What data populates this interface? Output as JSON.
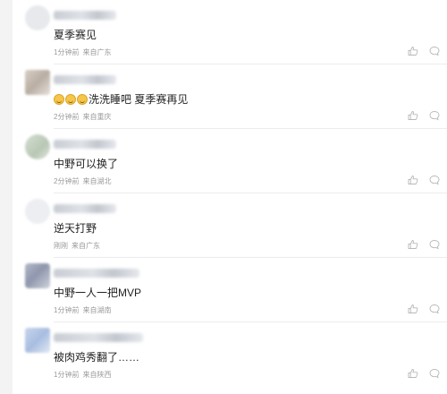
{
  "comments": [
    {
      "text": "夏季赛见",
      "time": "1分钟前",
      "location": "来自广东"
    },
    {
      "emoji": [
        "laugh-cry-emoji",
        "laugh-cry-emoji",
        "laugh-cry-emoji"
      ],
      "text": "洗洗睡吧 夏季赛再见",
      "time": "2分钟前",
      "location": "来自重庆"
    },
    {
      "text": "中野可以换了",
      "time": "2分钟前",
      "location": "来自湖北"
    },
    {
      "text": "逆天打野",
      "time": "刚刚",
      "location": "来自广东"
    },
    {
      "text": "中野一人一把MVP",
      "time": "1分钟前",
      "location": "来自湖南"
    },
    {
      "text": "被肉鸡秀翻了……",
      "time": "1分钟前",
      "location": "来自陕西"
    }
  ],
  "icons": {
    "like": "thumbs-up-icon",
    "reply": "comment-bubble-icon"
  },
  "colors": {
    "text": "#222222",
    "meta": "#9a9a9a",
    "icon": "#b8b8b8",
    "divider": "#ececec"
  }
}
